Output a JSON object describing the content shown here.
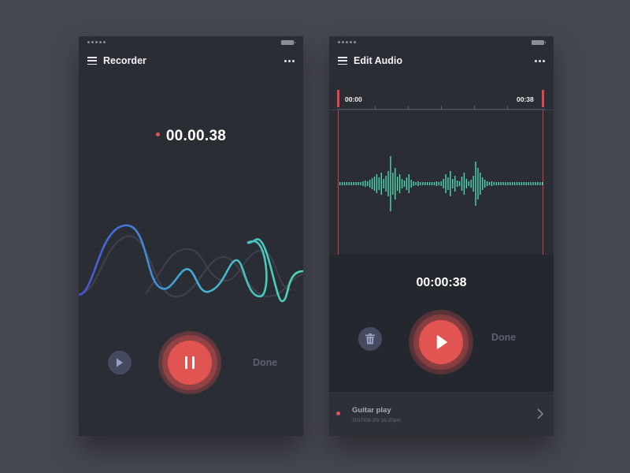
{
  "recorder": {
    "title": "Recorder",
    "timer": "00.00.38",
    "done_label": "Done"
  },
  "edit": {
    "title": "Edit Audio",
    "start_time": "00:00",
    "end_time": "00:38",
    "current_time": "00:00:38",
    "done_label": "Done",
    "file": {
      "name": "Guitar play",
      "date": "2017/08-20/ 16:20pm"
    }
  },
  "colors": {
    "accent": "#e25451",
    "waveform": "#4ed9b0",
    "wave_start": "#4a5bd6",
    "panel": "#2b2d35",
    "background": "#454750"
  },
  "icons": [
    "menu-icon",
    "more-icon",
    "play-icon",
    "pause-icon",
    "trash-icon",
    "chevron-right-icon",
    "battery-icon",
    "signal-icon"
  ]
}
